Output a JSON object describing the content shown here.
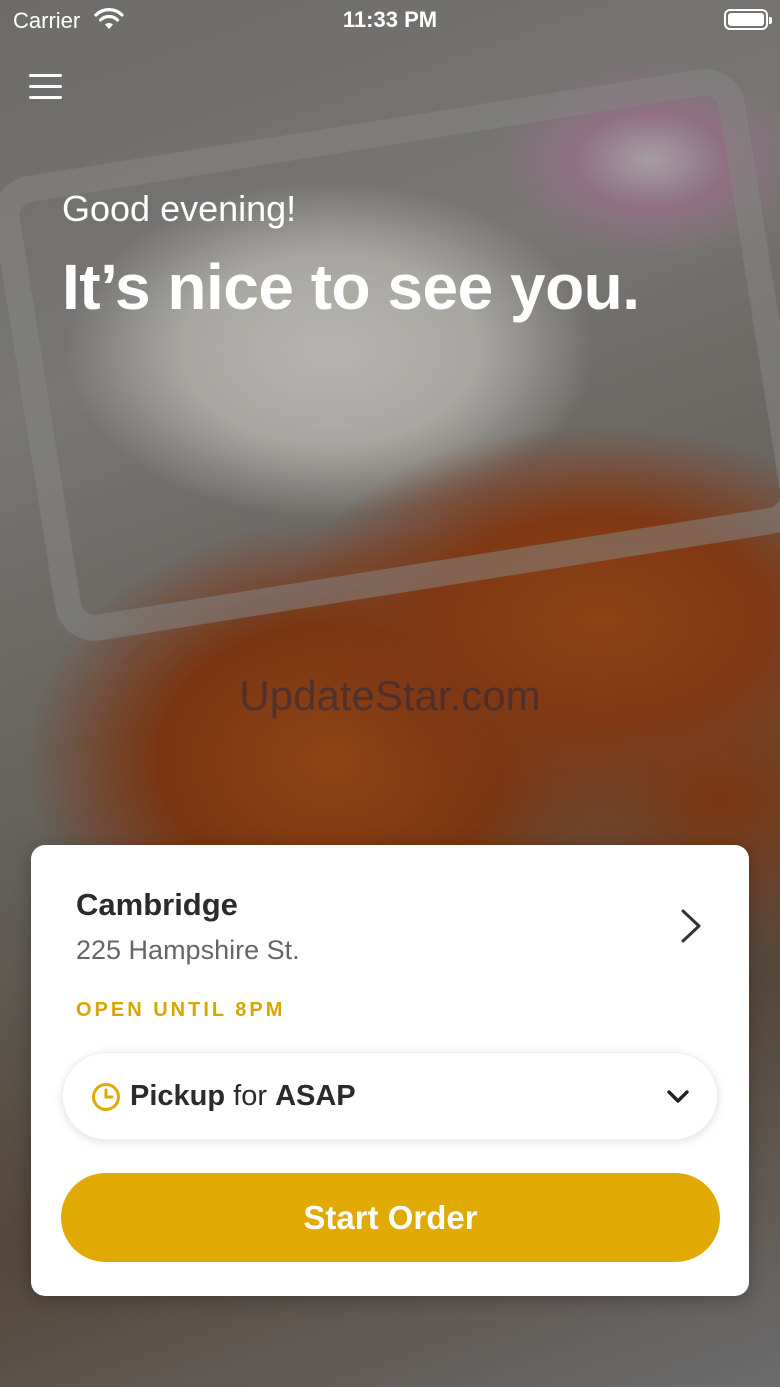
{
  "status_bar": {
    "carrier": "Carrier",
    "time": "11:33 PM"
  },
  "hero": {
    "greeting": "Good evening!",
    "headline": "It’s nice to see you.",
    "watermark": "UpdateStar.com"
  },
  "location_card": {
    "name": "Cambridge",
    "address": "225 Hampshire St.",
    "hours": "OPEN UNTIL 8PM",
    "order_mode": {
      "type": "Pickup",
      "connector": "for",
      "time": "ASAP"
    },
    "start_button": "Start Order"
  },
  "colors": {
    "accent": "#e1a903",
    "hours_text": "#d9a404",
    "card_bg": "#ffffff"
  },
  "icons": {
    "menu": "hamburger-icon",
    "wifi": "wifi-icon",
    "battery": "battery-icon",
    "chevron_right": "chevron-right-icon",
    "clock": "clock-icon",
    "chevron_down": "chevron-down-icon"
  }
}
